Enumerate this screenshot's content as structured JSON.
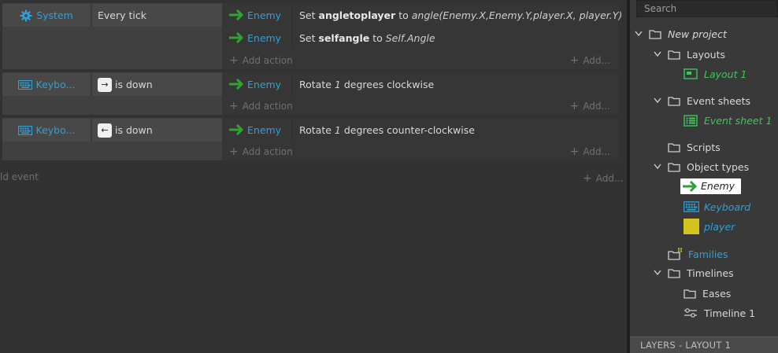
{
  "events": [
    {
      "condition": {
        "object": "System",
        "text": "Every tick",
        "icon": "gear-icon"
      },
      "actions": [
        {
          "object": "Enemy",
          "verb": "Set",
          "bold": "angletoplayer",
          "mid": "to",
          "italic": "angle(Enemy.X,Enemy.Y,player.X, player.Y)"
        },
        {
          "object": "Enemy",
          "verb": "Set",
          "bold": "selfangle",
          "mid": "to",
          "italic": "Self.Angle"
        }
      ],
      "add_action": "Add action",
      "add_right": "Add..."
    },
    {
      "condition": {
        "object": "Keybo...",
        "key": "→",
        "text": "is down",
        "icon": "keyboard-icon"
      },
      "actions": [
        {
          "object": "Enemy",
          "pre": "Rotate",
          "italic": "1",
          "post": "degrees clockwise"
        }
      ],
      "add_action": "Add action",
      "add_right": "Add..."
    },
    {
      "condition": {
        "object": "Keybo...",
        "key": "←",
        "text": "is down",
        "icon": "keyboard-icon"
      },
      "actions": [
        {
          "object": "Enemy",
          "pre": "Rotate",
          "italic": "1",
          "post": "degrees counter-clockwise"
        }
      ],
      "add_action": "Add action",
      "add_right": "Add..."
    }
  ],
  "add_event": "ld event",
  "add_bottom": "Add...",
  "project": {
    "search_placeholder": "Search",
    "root": "New project",
    "layouts": "Layouts",
    "layout_1": "Layout 1",
    "event_sheets": "Event sheets",
    "event_sheet_1": "Event sheet 1",
    "scripts": "Scripts",
    "object_types": "Object types",
    "obj_enemy": "Enemy",
    "obj_keyboard": "Keyboard",
    "obj_player": "player",
    "families": "Families",
    "timelines": "Timelines",
    "eases": "Eases",
    "timeline_1": "Timeline 1"
  },
  "layers_bar": "LAYERS - LAYOUT 1",
  "colors": {
    "object_blue": "#2ea0d8",
    "green": "#3bc65b",
    "arrow_green": "#2fa32f",
    "player_yellow": "#d4c21e"
  }
}
